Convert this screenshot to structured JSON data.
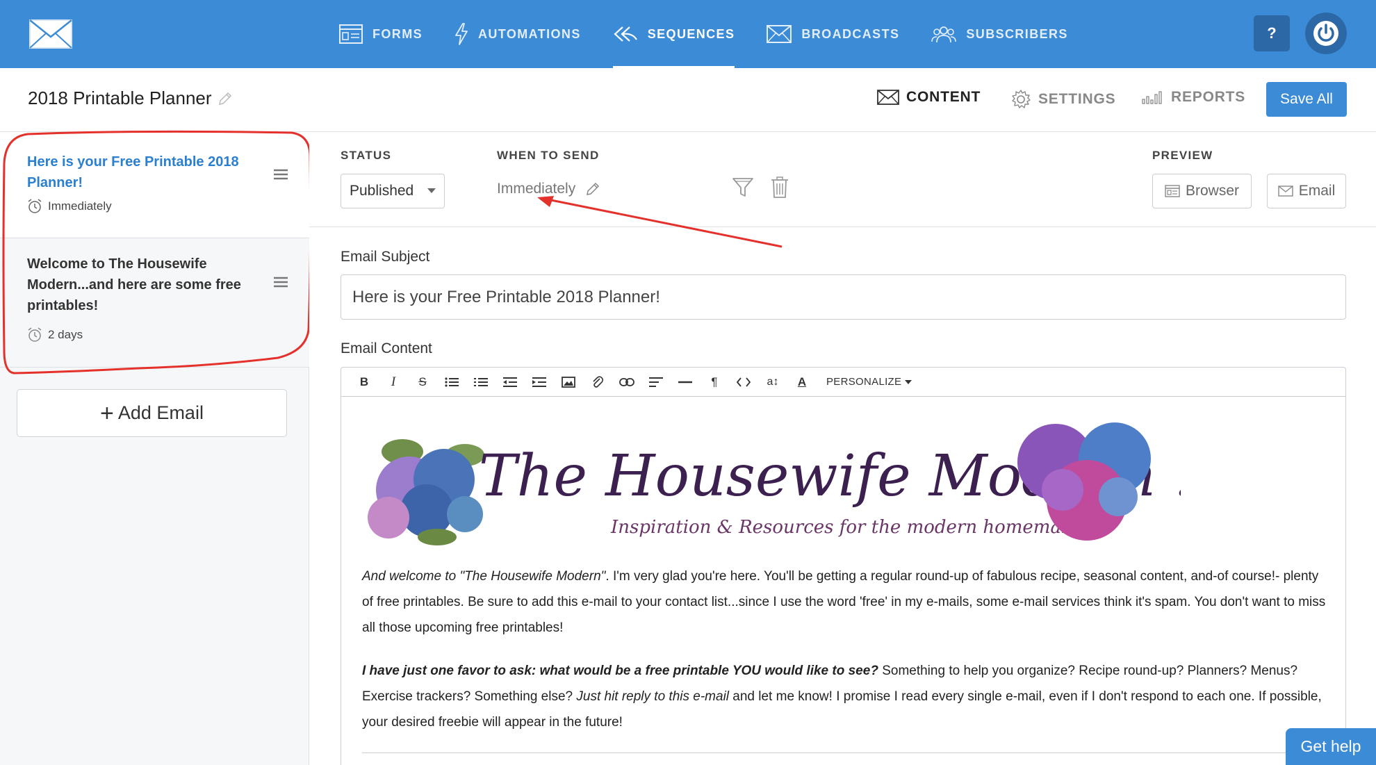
{
  "nav": {
    "items": [
      {
        "label": "FORMS",
        "icon": "form-icon"
      },
      {
        "label": "AUTOMATIONS",
        "icon": "lightning-icon"
      },
      {
        "label": "SEQUENCES",
        "icon": "sequence-arrows-icon",
        "active": true
      },
      {
        "label": "BROADCASTS",
        "icon": "envelope-icon"
      },
      {
        "label": "SUBSCRIBERS",
        "icon": "users-icon"
      }
    ],
    "help_label": "?",
    "accent": "#3c8bd6"
  },
  "header": {
    "title": "2018 Printable Planner",
    "tabs": [
      {
        "label": "CONTENT",
        "icon": "envelope-icon",
        "active": true
      },
      {
        "label": "SETTINGS",
        "icon": "gear-icon"
      },
      {
        "label": "REPORTS",
        "icon": "bar-chart-icon"
      }
    ],
    "save_label": "Save All"
  },
  "sidebar": {
    "emails": [
      {
        "title": "Here is your Free Printable 2018 Planner!",
        "delay": "Immediately",
        "active": true
      },
      {
        "title": "Welcome to The Housewife Modern...and here are some free printables!",
        "delay": "2 days"
      }
    ],
    "add_label": "Add Email"
  },
  "settings": {
    "status_label": "STATUS",
    "status_value": "Published",
    "when_label": "WHEN TO SEND",
    "when_value": "Immediately",
    "preview_label": "PREVIEW",
    "preview_browser": "Browser",
    "preview_email": "Email"
  },
  "subject": {
    "label": "Email Subject",
    "value": "Here is your Free Printable 2018 Planner!"
  },
  "content": {
    "label": "Email Content",
    "toolbar_personalize": "PERSONALIZE",
    "banner_title": "The Housewife Modern ...",
    "banner_tagline": "Inspiration & Resources for the modern homemaker",
    "p1_em": "And welcome to \"The Housewife Modern\"",
    "p1_rest": ". I'm very glad you're here. You'll be getting a regular round-up of fabulous recipe, seasonal content, and-of course!- plenty of free printables. Be sure to add this e-mail to your contact list...since I use the word 'free' in my e-mails, some e-mail services think it's spam. You don't want to miss all those upcoming free printables!",
    "p2_strong": "I have just one favor to ask: what would be a free printable YOU would like to see?",
    "p2_mid": " Something to help you organize? Recipe round-up? Planners? Menus? Exercise trackers? Something else? ",
    "p2_em": "Just hit reply to this e-mail",
    "p2_rest": " and let me know! I promise I read every single e-mail, even if I don't respond to each one. If possible, your desired freebie will appear in the future!"
  },
  "get_help": "Get help"
}
